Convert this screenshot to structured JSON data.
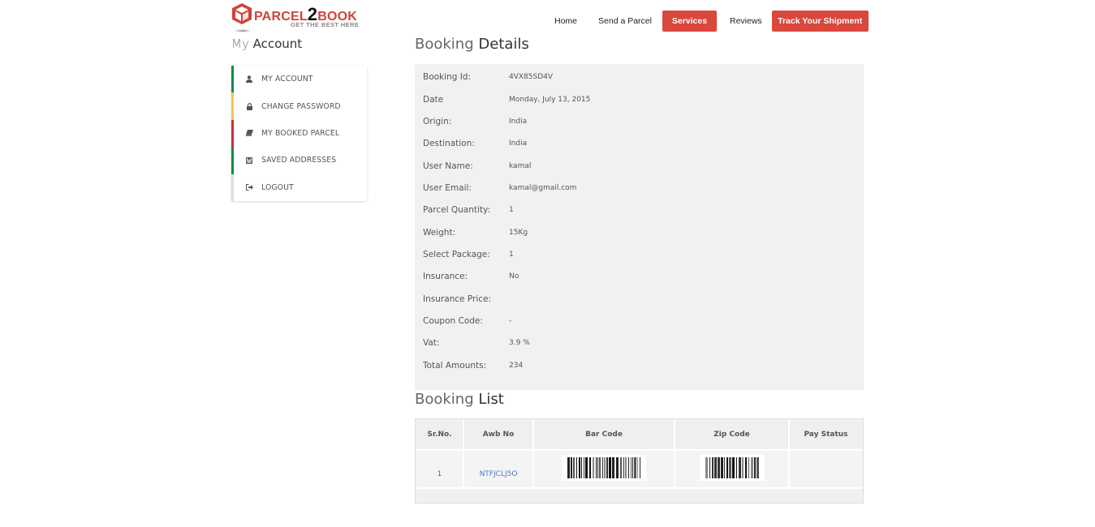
{
  "brand": {
    "name_part1": "Parcel",
    "name_digit": "2",
    "name_part2": "Book",
    "tagline": "GET THE BEST HERE",
    "color_primary": "#d0433a"
  },
  "nav": {
    "items": [
      {
        "label": "Home",
        "style": "plain"
      },
      {
        "label": "Send a Parcel",
        "style": "plain"
      },
      {
        "label": "Services",
        "style": "button"
      },
      {
        "label": "Reviews",
        "style": "plain"
      },
      {
        "label": "Track Your Shipment",
        "style": "button"
      }
    ],
    "button_color": "#d9473d"
  },
  "sidebar": {
    "title_light": "My",
    "title_strong": "Account",
    "items": [
      {
        "label": "MY ACCOUNT",
        "icon": "user-icon",
        "accent": "#0f8a4c"
      },
      {
        "label": "CHANGE PASSWORD",
        "icon": "lock-icon",
        "accent": "#f5c84e"
      },
      {
        "label": "MY BOOKED PARCEL",
        "icon": "book-icon",
        "accent": "#d02b38"
      },
      {
        "label": "SAVED ADDRESSES",
        "icon": "save-icon",
        "accent": "#0f8a4c"
      },
      {
        "label": "LOGOUT",
        "icon": "sign-out-icon",
        "accent": "#e0e0d5"
      }
    ]
  },
  "details": {
    "title_light": "Booking",
    "title_strong": "Details",
    "rows": [
      {
        "label": "Booking Id:",
        "value": "4VX85SD4V"
      },
      {
        "label": "Date",
        "value": "Monday, July 13, 2015"
      },
      {
        "label": "Origin:",
        "value": "India"
      },
      {
        "label": "Destination:",
        "value": "India"
      },
      {
        "label": "User Name:",
        "value": "kamal"
      },
      {
        "label": "User Email:",
        "value": "kamal@gmail.com"
      },
      {
        "label": "Parcel Quantity:",
        "value": "1"
      },
      {
        "label": "Weight:",
        "value": "15Kg"
      },
      {
        "label": "Select Package:",
        "value": "1"
      },
      {
        "label": "Insurance:",
        "value": "No"
      },
      {
        "label": "Insurance Price:",
        "value": ""
      },
      {
        "label": "Coupon Code:",
        "value": "-"
      },
      {
        "label": "Vat:",
        "value": "3.9 %"
      },
      {
        "label": "Total Amounts:",
        "value": "234"
      }
    ]
  },
  "booking_list": {
    "title_light": "Booking",
    "title_strong": "List",
    "columns": [
      "Sr.No.",
      "Awb No",
      "Bar Code",
      "Zip Code",
      "Pay Status"
    ],
    "rows": [
      {
        "sr_no": "1",
        "awb_no": "NTFJCLJ5O",
        "bar_code": "barcode-image",
        "zip_code": "barcode-image",
        "pay_status": ""
      }
    ]
  }
}
